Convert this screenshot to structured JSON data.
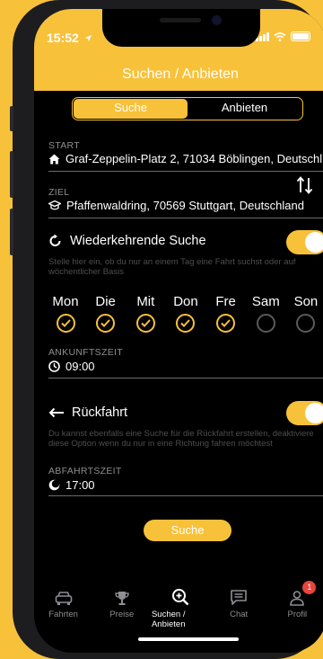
{
  "status": {
    "time": "15:52"
  },
  "header": {
    "title": "Suchen / Anbieten"
  },
  "segment": {
    "search": "Suche",
    "offer": "Anbieten"
  },
  "start": {
    "label": "START",
    "value": "Graf-Zeppelin-Platz 2, 71034 Böblingen, Deutschl..."
  },
  "destination": {
    "label": "ZIEL",
    "value": "Pfaffenwaldring, 70569 Stuttgart, Deutschland"
  },
  "recurring": {
    "title": "Wiederkehrende Suche",
    "enabled": true,
    "helper": "Stelle hier ein, ob du nur an einem Tag eine Fahrt suchst oder auf wöchentlicher Basis"
  },
  "days": [
    {
      "label": "Mon",
      "checked": true
    },
    {
      "label": "Die",
      "checked": true
    },
    {
      "label": "Mit",
      "checked": true
    },
    {
      "label": "Don",
      "checked": true
    },
    {
      "label": "Fre",
      "checked": true
    },
    {
      "label": "Sam",
      "checked": false
    },
    {
      "label": "Son",
      "checked": false
    }
  ],
  "arrival": {
    "label": "ANKUNFTSZEIT",
    "value": "09:00"
  },
  "return_trip": {
    "title": "Rückfahrt",
    "enabled": true,
    "helper": "Du kannst ebenfalls eine Suche für die Rückfahrt erstellen, deaktiviere diese Option wenn du nur in eine Richtung fahren möchtest"
  },
  "departure": {
    "label": "ABFAHRTSZEIT",
    "value": "17:00"
  },
  "search_button": "Suche",
  "tabs": [
    {
      "label": "Fahrten",
      "icon": "car-icon"
    },
    {
      "label": "Preise",
      "icon": "trophy-icon"
    },
    {
      "label": "Suchen / Anbieten",
      "icon": "search-plus-icon"
    },
    {
      "label": "Chat",
      "icon": "chat-icon"
    },
    {
      "label": "Profil",
      "icon": "profile-icon",
      "badge": "1"
    }
  ],
  "colors": {
    "accent": "#f8c13a",
    "background": "#000000",
    "badge": "#e8453c"
  }
}
